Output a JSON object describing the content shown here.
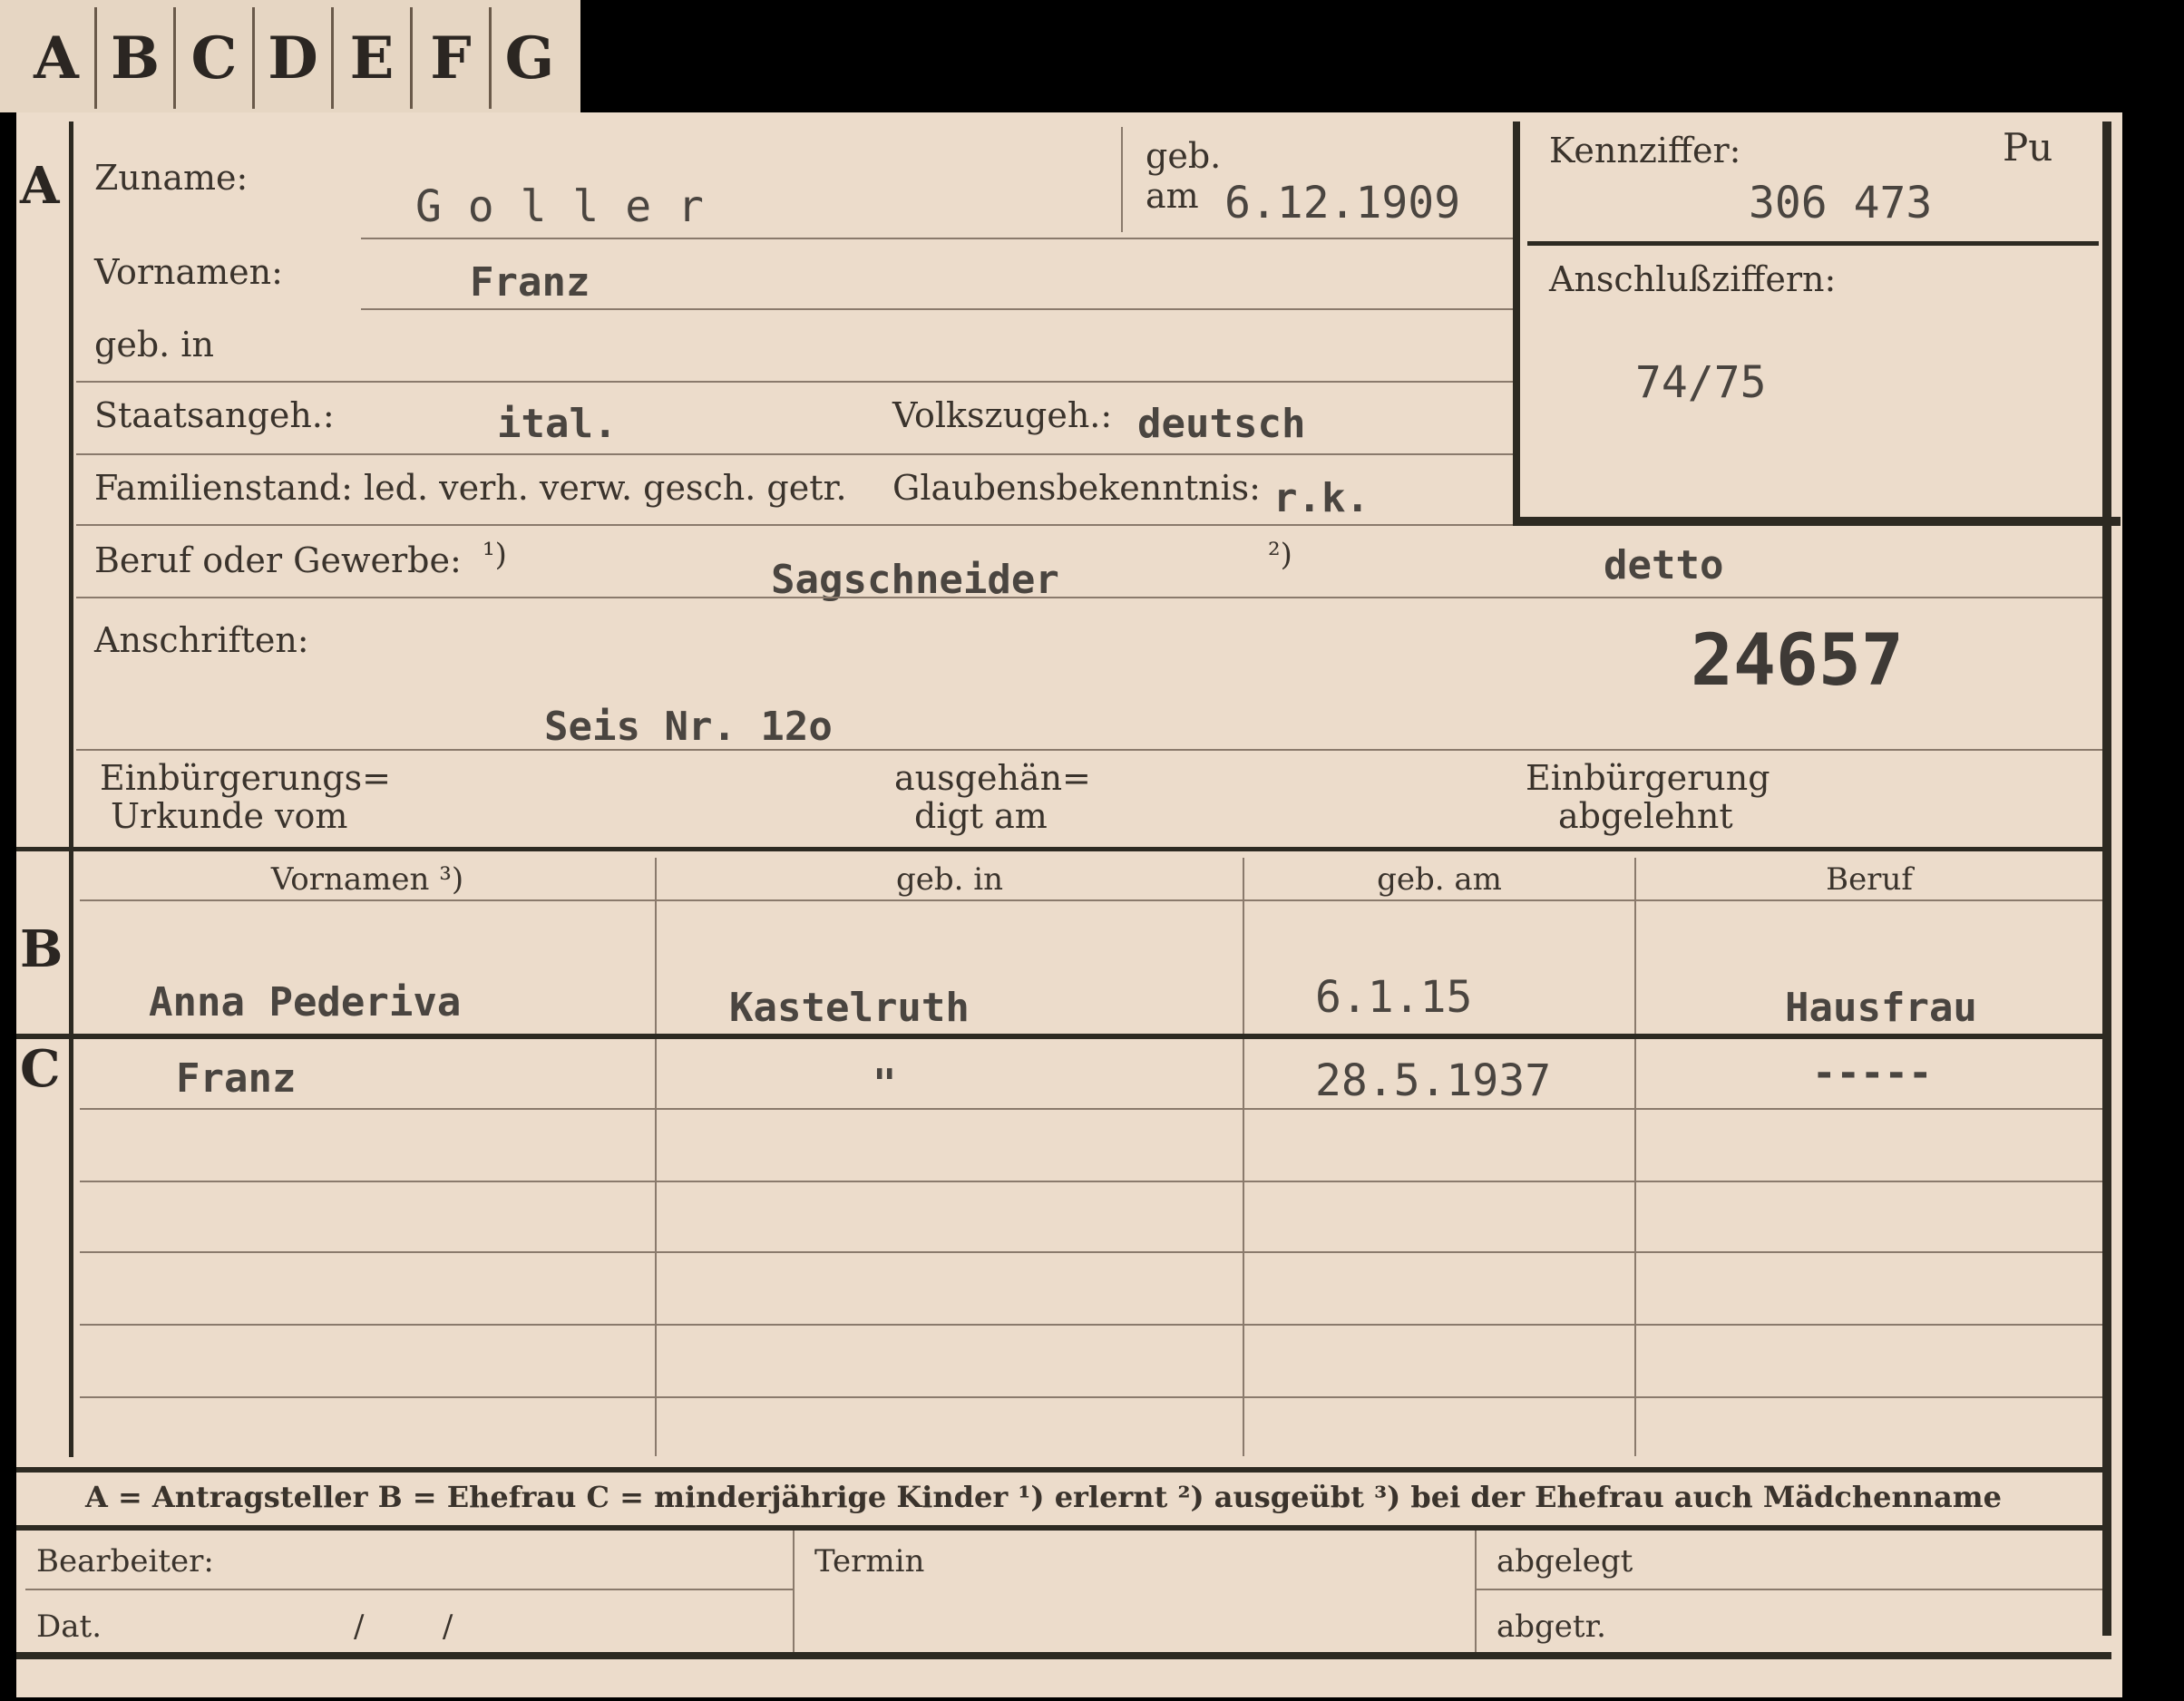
{
  "tabs": [
    "A",
    "B",
    "C",
    "D",
    "E",
    "F",
    "G"
  ],
  "sections": {
    "a": "A",
    "b": "B",
    "c": "C"
  },
  "applicant": {
    "surname_label": "Zuname:",
    "surname": "G o l l e r",
    "born_label_1": "geb.",
    "born_label_2": "am",
    "born_date": "6.12.1909",
    "firstname_label": "Vornamen:",
    "firstname": "Franz",
    "birthplace_label": "geb. in",
    "citizenship_label": "Staatsangeh.:",
    "citizenship": "ital.",
    "ethnicity_label": "Volkszugeh.:",
    "ethnicity": "deutsch",
    "marital_label": "Familienstand: led. verh. verw. gesch. getr.",
    "religion_label": "Glaubensbekenntnis:",
    "religion": "r.k.",
    "profession_label": "Beruf oder Gewerbe:",
    "profession_note1": "¹)",
    "profession": "Sagschneider",
    "profession_note2": "²)",
    "profession_practiced": "detto",
    "address_label": "Anschriften:",
    "address": "Seis Nr. 12o",
    "stamp_number": "24657",
    "natur_label_1": "Einbürgerungs=",
    "natur_label_2": "Urkunde vom",
    "handed_label_1": "ausgehän=",
    "handed_label_2": "digt am",
    "rejected_label_1": "Einbürgerung",
    "rejected_label_2": "abgelehnt"
  },
  "idbox": {
    "code_label": "Kennziffer:",
    "code_tag": "Pu",
    "code": "306 473",
    "sub_label": "Anschlußziffern:",
    "sub_code": "74/75"
  },
  "family_headers": [
    "Vornamen ³)",
    "geb. in",
    "geb. am",
    "Beruf"
  ],
  "spouse": {
    "name": "Anna Pederiva",
    "birthplace": "Kastelruth",
    "birthdate": "6.1.15",
    "profession": "Hausfrau"
  },
  "child": {
    "name": "Franz",
    "birthplace": "\"",
    "birthdate": "28.5.1937",
    "profession": "-----"
  },
  "legend": "A = Antragsteller   B = Ehefrau   C = minderjährige Kinder  ¹) erlernt   ²) ausgeübt   ³) bei der Ehefrau auch Mädchenname",
  "footer": {
    "clerk_label": "Bearbeiter:",
    "date_label": "Dat.",
    "date_value": "/        /",
    "deadline_label": "Termin",
    "filed_label": "abgelegt",
    "copied_label": "abgetr."
  }
}
